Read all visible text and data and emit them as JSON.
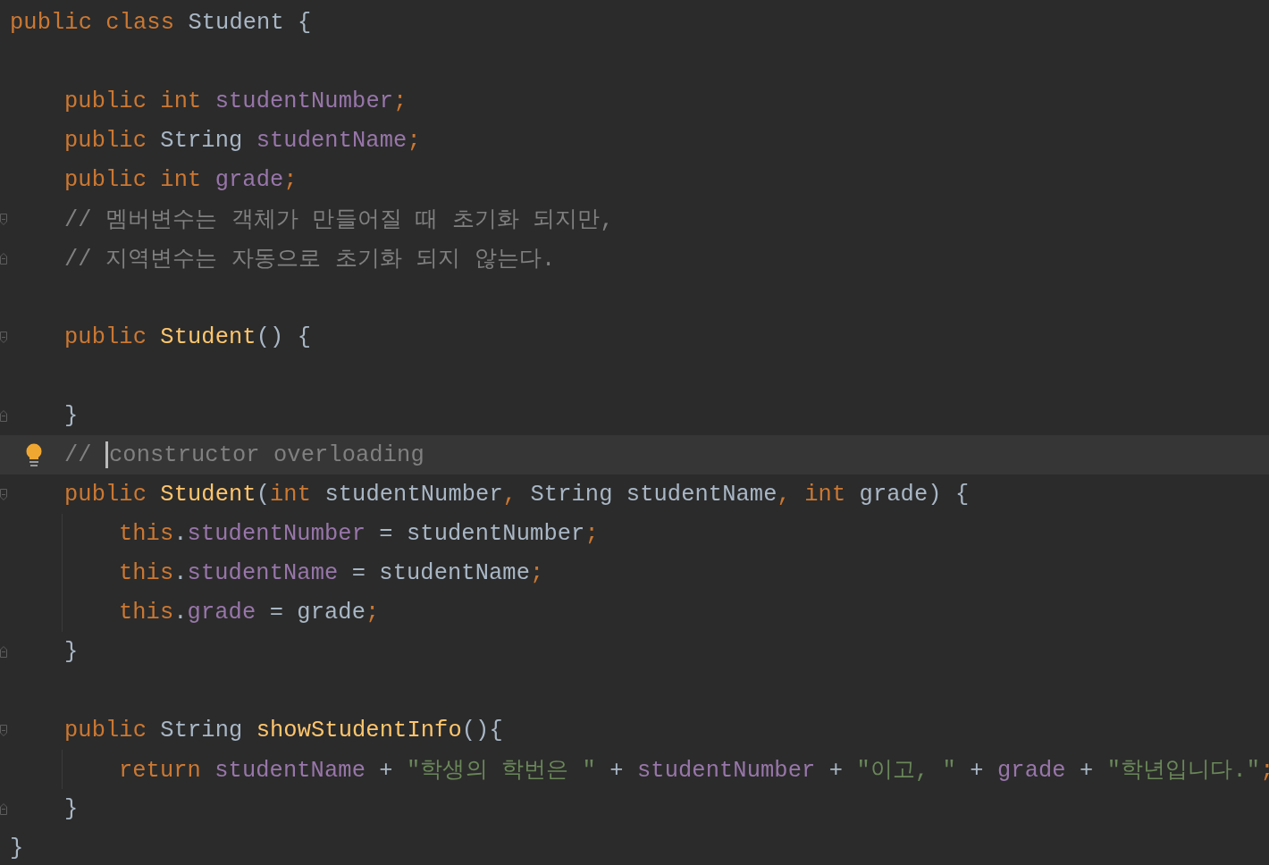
{
  "editor": {
    "lines": [
      {
        "tokens": [
          {
            "kind": "kw",
            "t": "public class "
          },
          {
            "kind": "plain",
            "t": "Student {"
          }
        ]
      },
      {
        "blank": true
      },
      {
        "tokens": [
          {
            "kind": "kw",
            "t": "    public int "
          },
          {
            "kind": "field",
            "t": "studentNumber"
          },
          {
            "kind": "kw",
            "t": ";"
          }
        ]
      },
      {
        "tokens": [
          {
            "kind": "kw",
            "t": "    public "
          },
          {
            "kind": "plain",
            "t": "String "
          },
          {
            "kind": "field",
            "t": "studentName"
          },
          {
            "kind": "kw",
            "t": ";"
          }
        ]
      },
      {
        "tokens": [
          {
            "kind": "kw",
            "t": "    public int "
          },
          {
            "kind": "field",
            "t": "grade"
          },
          {
            "kind": "kw",
            "t": ";"
          }
        ]
      },
      {
        "fold": {
          "kind": "start"
        },
        "tokens": [
          {
            "kind": "comment",
            "t": "    // 멤버변수는 객체가 만들어질 때 초기화 되지만,"
          }
        ]
      },
      {
        "fold": {
          "kind": "end"
        },
        "tokens": [
          {
            "kind": "comment",
            "t": "    // 지역변수는 자동으로 초기화 되지 않는다."
          }
        ]
      },
      {
        "blank": true
      },
      {
        "fold": {
          "kind": "start"
        },
        "tokens": [
          {
            "kind": "kw",
            "t": "    public "
          },
          {
            "kind": "method",
            "t": "Student"
          },
          {
            "kind": "plain",
            "t": "() {"
          }
        ]
      },
      {
        "blank": true
      },
      {
        "fold": {
          "kind": "end"
        },
        "tokens": [
          {
            "kind": "plain",
            "t": "    }"
          }
        ]
      },
      {
        "bulb": true,
        "tokens": [
          {
            "kind": "comment",
            "t": "    // "
          },
          {
            "kind": "comment",
            "t": "constructor overloading",
            "caret": true
          }
        ]
      },
      {
        "fold": {
          "kind": "start"
        },
        "tokens": [
          {
            "kind": "kw",
            "t": "    public "
          },
          {
            "kind": "method",
            "t": "Student"
          },
          {
            "kind": "plain",
            "t": "("
          },
          {
            "kind": "kw",
            "t": "int "
          },
          {
            "kind": "plain",
            "t": "studentNumber"
          },
          {
            "kind": "kw",
            "t": ", "
          },
          {
            "kind": "plain",
            "t": "String studentName"
          },
          {
            "kind": "kw",
            "t": ", int "
          },
          {
            "kind": "plain",
            "t": "grade) {"
          }
        ]
      },
      {
        "guide": true,
        "tokens": [
          {
            "kind": "kw",
            "t": "        this"
          },
          {
            "kind": "plain",
            "t": "."
          },
          {
            "kind": "field",
            "t": "studentNumber"
          },
          {
            "kind": "plain",
            "t": " = studentNumber"
          },
          {
            "kind": "kw",
            "t": ";"
          }
        ]
      },
      {
        "guide": true,
        "tokens": [
          {
            "kind": "kw",
            "t": "        this"
          },
          {
            "kind": "plain",
            "t": "."
          },
          {
            "kind": "field",
            "t": "studentName"
          },
          {
            "kind": "plain",
            "t": " = studentName"
          },
          {
            "kind": "kw",
            "t": ";"
          }
        ]
      },
      {
        "guide": true,
        "tokens": [
          {
            "kind": "kw",
            "t": "        this"
          },
          {
            "kind": "plain",
            "t": "."
          },
          {
            "kind": "field",
            "t": "grade"
          },
          {
            "kind": "plain",
            "t": " = grade"
          },
          {
            "kind": "kw",
            "t": ";"
          }
        ]
      },
      {
        "fold": {
          "kind": "end"
        },
        "tokens": [
          {
            "kind": "plain",
            "t": "    }"
          }
        ]
      },
      {
        "blank": true
      },
      {
        "fold": {
          "kind": "start"
        },
        "tokens": [
          {
            "kind": "kw",
            "t": "    public "
          },
          {
            "kind": "plain",
            "t": "String "
          },
          {
            "kind": "method",
            "t": "showStudentInfo"
          },
          {
            "kind": "plain",
            "t": "(){"
          }
        ]
      },
      {
        "guide": true,
        "tokens": [
          {
            "kind": "kw",
            "t": "        return "
          },
          {
            "kind": "field",
            "t": "studentName"
          },
          {
            "kind": "plain",
            "t": " + "
          },
          {
            "kind": "string",
            "t": "\"학생의 학번은 \""
          },
          {
            "kind": "plain",
            "t": " + "
          },
          {
            "kind": "field",
            "t": "studentNumber"
          },
          {
            "kind": "plain",
            "t": " + "
          },
          {
            "kind": "string",
            "t": "\"이고, \""
          },
          {
            "kind": "plain",
            "t": " + "
          },
          {
            "kind": "field",
            "t": "grade"
          },
          {
            "kind": "plain",
            "t": " + "
          },
          {
            "kind": "string",
            "t": "\"학년입니다.\""
          },
          {
            "kind": "kw",
            "t": ";"
          }
        ]
      },
      {
        "fold": {
          "kind": "end"
        },
        "tokens": [
          {
            "kind": "plain",
            "t": "    }"
          }
        ]
      },
      {
        "tokens": [
          {
            "kind": "plain",
            "t": "}"
          }
        ]
      }
    ]
  }
}
